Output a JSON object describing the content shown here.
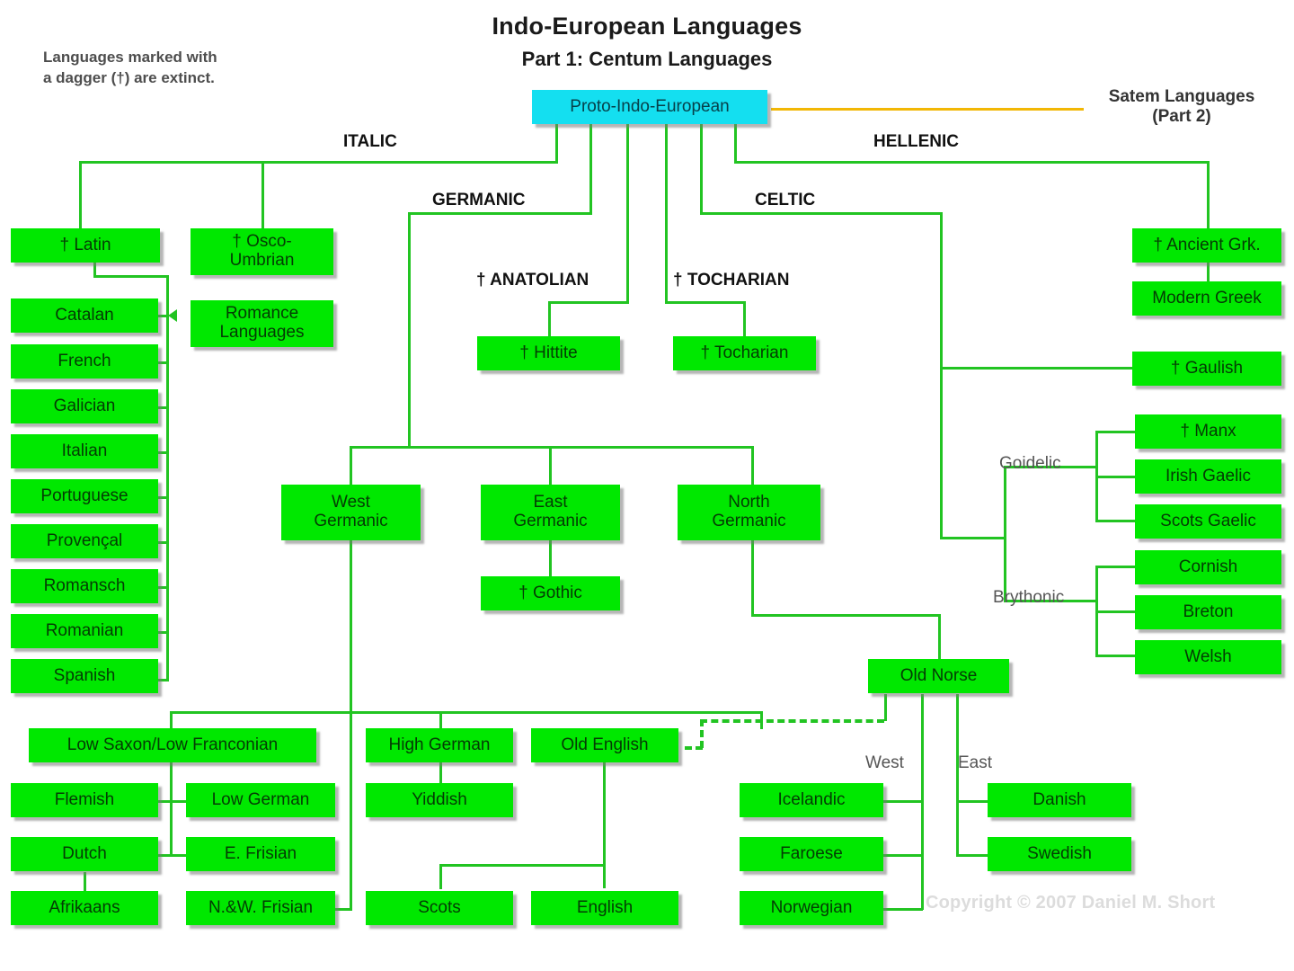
{
  "header": {
    "title": "Indo-European Languages",
    "subtitle": "Part 1: Centum Languages",
    "legend": "Languages marked with\na dagger (†) are extinct.",
    "satem_note": "Satem Languages\n(Part 2)",
    "copyright": "Copyright © 2007 Daniel M. Short"
  },
  "colors": {
    "node_fill": "#00e800",
    "root_fill": "#14dff0",
    "connector": "#22c422",
    "satem_connector": "#f2b705",
    "text": "#043b04",
    "background": "#ffffff"
  },
  "branch_labels": {
    "italic": "ITALIC",
    "germanic": "GERMANIC",
    "hellenic": "HELLENIC",
    "celtic": "CELTIC",
    "anatolian": "† ANATOLIAN",
    "tocharian": "† TOCHARIAN",
    "goidelic": "Goidelic",
    "brythonic": "Brythonic",
    "norse_west": "West",
    "norse_east": "East"
  },
  "nodes": {
    "root": "Proto-Indo-European",
    "latin": "† Latin",
    "osco_umbrian": "† Osco-\nUmbrian",
    "romance_languages": "Romance\nLanguages",
    "catalan": "Catalan",
    "french": "French",
    "galician": "Galician",
    "italian": "Italian",
    "portuguese": "Portuguese",
    "provencal": "Provençal",
    "romansch": "Romansch",
    "romanian": "Romanian",
    "spanish": "Spanish",
    "hittite": "† Hittite",
    "tocharian": "† Tocharian",
    "ancient_greek": "† Ancient Grk.",
    "modern_greek": "Modern Greek",
    "gaulish": "† Gaulish",
    "manx": "† Manx",
    "irish_gaelic": "Irish Gaelic",
    "scots_gaelic": "Scots Gaelic",
    "cornish": "Cornish",
    "breton": "Breton",
    "welsh": "Welsh",
    "west_germanic": "West\nGermanic",
    "east_germanic": "East\nGermanic",
    "north_germanic": "North\nGermanic",
    "gothic": "† Gothic",
    "old_norse": "Old Norse",
    "low_saxon": "Low Saxon/Low Franconian",
    "high_german": "High German",
    "old_english": "Old English",
    "flemish": "Flemish",
    "low_german": "Low German",
    "yiddish": "Yiddish",
    "dutch": "Dutch",
    "e_frisian": "E. Frisian",
    "afrikaans": "Afrikaans",
    "nw_frisian": "N.&W. Frisian",
    "scots": "Scots",
    "english": "English",
    "icelandic": "Icelandic",
    "faroese": "Faroese",
    "norwegian": "Norwegian",
    "danish": "Danish",
    "swedish": "Swedish"
  },
  "tree": {
    "type": "diagram",
    "root": "Proto-Indo-European",
    "branches": [
      {
        "name": "ITALIC",
        "children": [
          "† Latin",
          "† Osco-Umbrian"
        ]
      },
      {
        "name": "GERMANIC",
        "children": [
          "West Germanic",
          "East Germanic",
          "North Germanic"
        ]
      },
      {
        "name": "† ANATOLIAN",
        "children": [
          "† Hittite"
        ]
      },
      {
        "name": "† TOCHARIAN",
        "children": [
          "† Tocharian"
        ]
      },
      {
        "name": "CELTIC",
        "children": [
          "† Gaulish",
          "Goidelic",
          "Brythonic"
        ]
      },
      {
        "name": "HELLENIC",
        "children": [
          "† Ancient Grk."
        ]
      },
      {
        "name": "Satem Languages (Part 2)",
        "children": []
      }
    ],
    "sub": {
      "† Latin": [
        "Romance Languages"
      ],
      "Romance Languages": [
        "Catalan",
        "French",
        "Galician",
        "Italian",
        "Portuguese",
        "Provençal",
        "Romansch",
        "Romanian",
        "Spanish"
      ],
      "† Ancient Grk.": [
        "Modern Greek"
      ],
      "Goidelic": [
        "† Manx",
        "Irish Gaelic",
        "Scots Gaelic"
      ],
      "Brythonic": [
        "Cornish",
        "Breton",
        "Welsh"
      ],
      "East Germanic": [
        "† Gothic"
      ],
      "North Germanic": [
        "Old Norse"
      ],
      "Old Norse": {
        "West": [
          "Icelandic",
          "Faroese",
          "Norwegian"
        ],
        "East": [
          "Danish",
          "Swedish"
        ]
      },
      "West Germanic": [
        "Low Saxon/Low Franconian",
        "High German",
        "Old English"
      ],
      "Low Saxon/Low Franconian": [
        "Flemish",
        "Low German",
        "Dutch",
        "E. Frisian",
        "N.&W. Frisian"
      ],
      "Dutch": [
        "Afrikaans"
      ],
      "High German": [
        "Yiddish"
      ],
      "Old English": [
        "Scots",
        "English"
      ]
    }
  }
}
